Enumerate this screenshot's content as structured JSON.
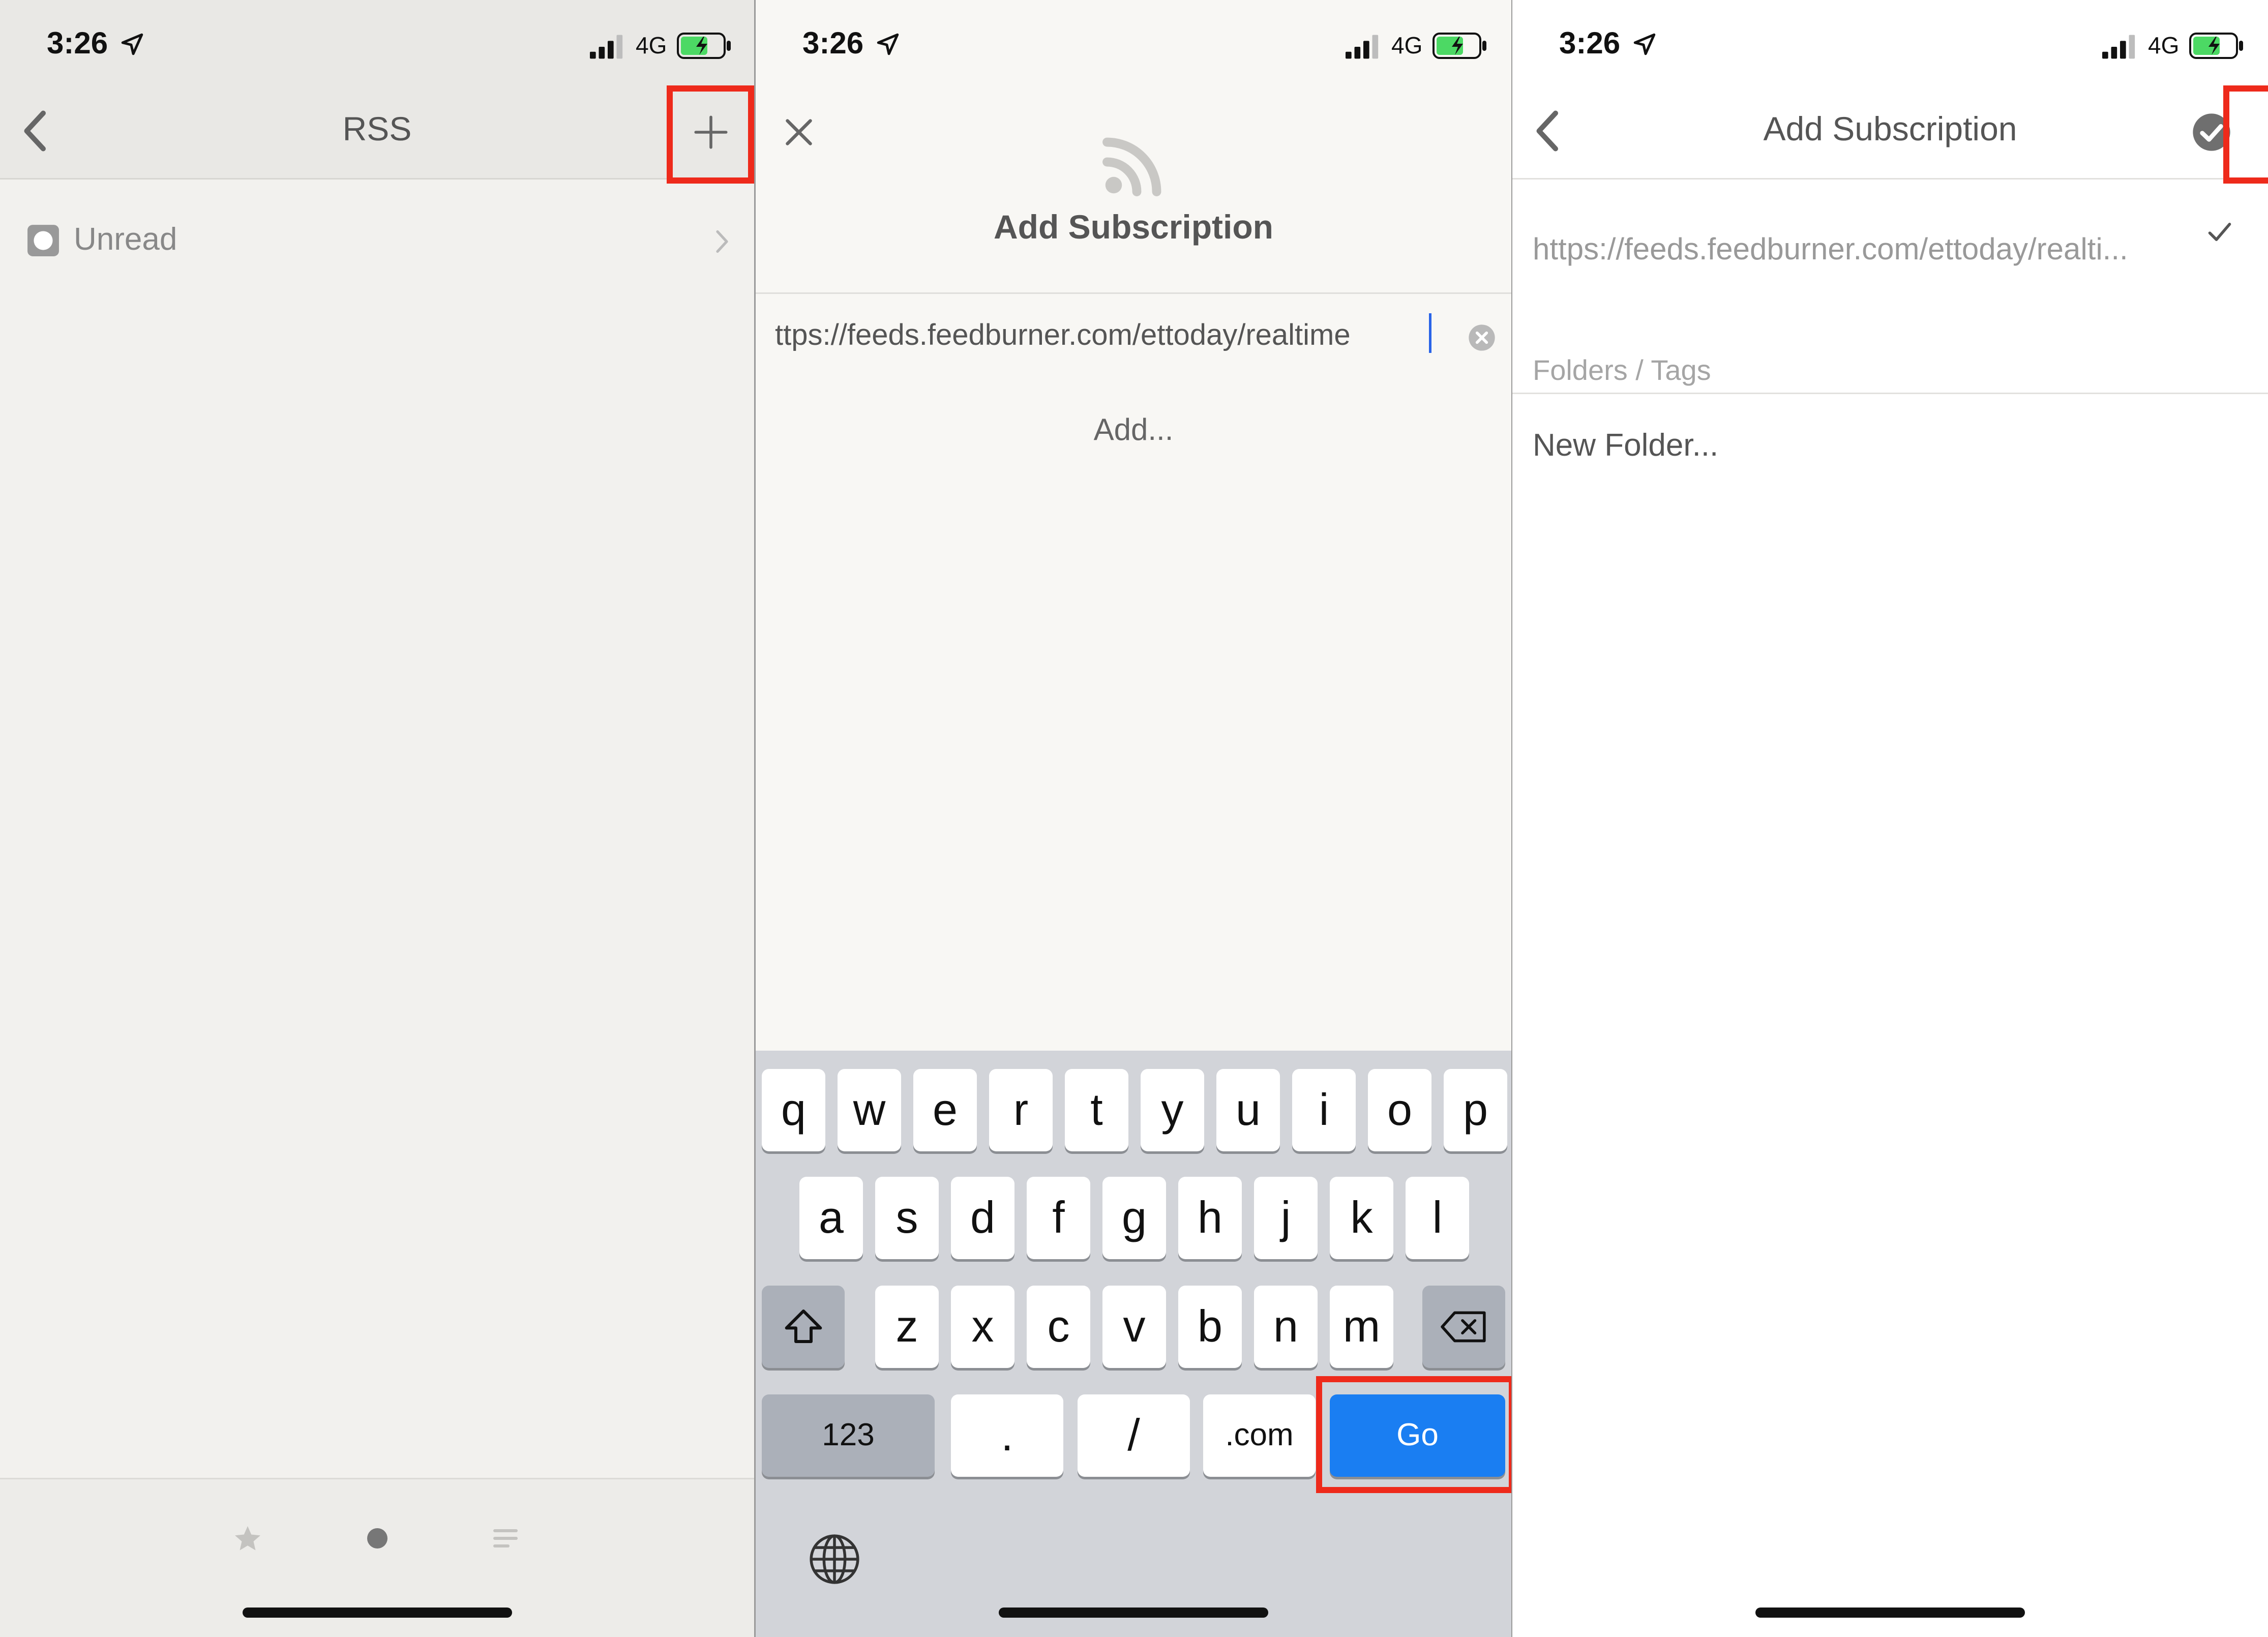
{
  "status_bar": {
    "time": "3:26",
    "network": "4G"
  },
  "panel1": {
    "nav_title": "RSS",
    "unread_label": "Unread"
  },
  "panel2": {
    "title": "Add Subscription",
    "url_value": "ttps://feeds.feedburner.com/ettoday/realtime",
    "add_label": "Add...",
    "keyboard": {
      "row1": [
        "q",
        "w",
        "e",
        "r",
        "t",
        "y",
        "u",
        "i",
        "o",
        "p"
      ],
      "row2": [
        "a",
        "s",
        "d",
        "f",
        "g",
        "h",
        "j",
        "k",
        "l"
      ],
      "row3": [
        "z",
        "x",
        "c",
        "v",
        "b",
        "n",
        "m"
      ],
      "numbers_label": "123",
      "dot_label": ".",
      "slash_label": "/",
      "dotcom_label": ".com",
      "go_label": "Go"
    }
  },
  "panel3": {
    "title": "Add Subscription",
    "url_display": "https://feeds.feedburner.com/ettoday/realti...",
    "section_label": "Folders / Tags",
    "new_folder_label": "New Folder..."
  },
  "colors": {
    "highlight": "#ee2a1b",
    "go_key": "#1a7ef2",
    "caret": "#2a64e8",
    "battery_fill": "#4cd964"
  }
}
